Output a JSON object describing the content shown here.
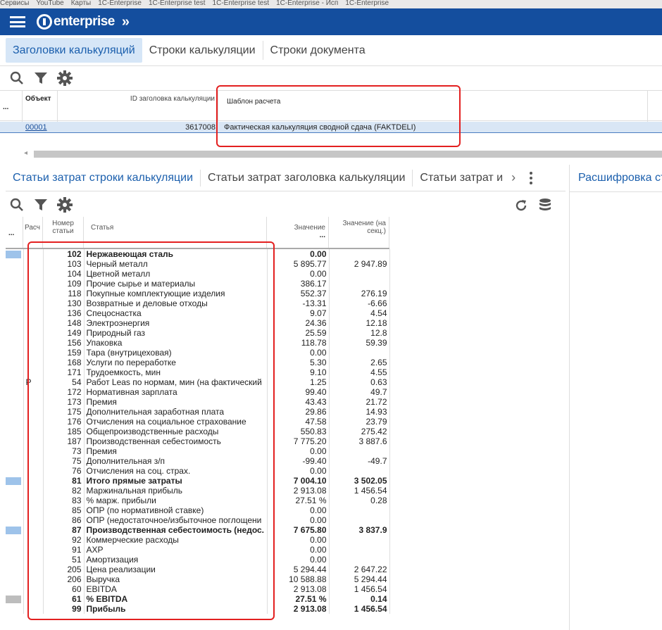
{
  "bookmarks": [
    "Сервисы",
    "YouTube",
    "Карты",
    "1C-Enterprise",
    "1C-Enterprise test",
    "1C-Enterprise test",
    "1C-Enterprise - Исп",
    "1C-Enterprise"
  ],
  "brand": {
    "name": "enterprise",
    "menu_icon": "hamburger-menu-icon",
    "nav_icon": "double-chevron-right-icon",
    "color": "#144e9e"
  },
  "top_tabs": [
    {
      "label": "Заголовки калькуляций",
      "active": true
    },
    {
      "label": "Строки калькуляции",
      "active": false
    },
    {
      "label": "Строки документа",
      "active": false
    }
  ],
  "header_grid": {
    "columns": {
      "more": "...",
      "object": "Объект",
      "id": "ID заголовка калькуляции",
      "template": "Шаблон расчета"
    },
    "row": {
      "object": "00001",
      "id": "3617008",
      "template": "Фактическая калькуляция сводной сдача (FAKTDELI)"
    }
  },
  "bottom_tabs": [
    {
      "label": "Статьи затрат строки калькуляции",
      "active": true
    },
    {
      "label": "Статьи затрат заголовка калькуляции",
      "active": false
    },
    {
      "label": "Статьи затрат и",
      "active": false
    }
  ],
  "bottom_tabs_more": "›",
  "right_panel_title": "Расшифровка ст",
  "lines_grid": {
    "columns": {
      "more": "...",
      "calc": "Расч",
      "number": "Номер статьи",
      "item": "Статья",
      "value": "Значение",
      "value_sub": "...",
      "sec_value": "Значение (на секц.)"
    },
    "rows": [
      {
        "num": "102",
        "name": "Нержавеющая сталь",
        "val": "0.00",
        "sec": "",
        "bold": true,
        "mark": "blue"
      },
      {
        "num": "103",
        "name": "Черный металл",
        "val": "5 895.77",
        "sec": "2 947.89"
      },
      {
        "num": "104",
        "name": "Цветной металл",
        "val": "0.00",
        "sec": ""
      },
      {
        "num": "109",
        "name": "Прочие сырье и материалы",
        "val": "386.17",
        "sec": ""
      },
      {
        "num": "118",
        "name": "Покупные комплектующие изделия",
        "val": "552.37",
        "sec": "276.19"
      },
      {
        "num": "130",
        "name": "Возвратные и деловые отходы",
        "val": "-13.31",
        "sec": "-6.66"
      },
      {
        "num": "136",
        "name": "Спецоснастка",
        "val": "9.07",
        "sec": "4.54"
      },
      {
        "num": "148",
        "name": "Электроэнергия",
        "val": "24.36",
        "sec": "12.18"
      },
      {
        "num": "149",
        "name": "Природный газ",
        "val": "25.59",
        "sec": "12.8"
      },
      {
        "num": "156",
        "name": "Упаковка",
        "val": "118.78",
        "sec": "59.39"
      },
      {
        "num": "159",
        "name": "Тара (внутрицеховая)",
        "val": "0.00",
        "sec": ""
      },
      {
        "num": "168",
        "name": "Услуги по переработке",
        "val": "5.30",
        "sec": "2.65"
      },
      {
        "num": "171",
        "name": "Трудоемкость, мин",
        "val": "9.10",
        "sec": "4.55"
      },
      {
        "num": "54",
        "name": "Работ Leas по нормам, мин (на фактический",
        "val": "1.25",
        "sec": "0.63",
        "calc": "P"
      },
      {
        "num": "172",
        "name": "Нормативная зарплата",
        "val": "99.40",
        "sec": "49.7"
      },
      {
        "num": "173",
        "name": "Премия",
        "val": "43.43",
        "sec": "21.72"
      },
      {
        "num": "175",
        "name": "Дополнительная заработная плата",
        "val": "29.86",
        "sec": "14.93"
      },
      {
        "num": "176",
        "name": "Отчисления на социальное страхование",
        "val": "47.58",
        "sec": "23.79"
      },
      {
        "num": "185",
        "name": "Общепроизводственные расходы",
        "val": "550.83",
        "sec": "275.42"
      },
      {
        "num": "187",
        "name": "Производственная себестоимость",
        "val": "7 775.20",
        "sec": "3 887.6"
      },
      {
        "num": "73",
        "name": "Премия",
        "val": "0.00",
        "sec": ""
      },
      {
        "num": "75",
        "name": "Дополнительная з/п",
        "val": "-99.40",
        "sec": "-49.7"
      },
      {
        "num": "76",
        "name": "Отчисления  на соц. страх.",
        "val": "0.00",
        "sec": ""
      },
      {
        "num": "81",
        "name": "Итого  прямые затраты",
        "val": "7 004.10",
        "sec": "3 502.05",
        "bold": true,
        "mark": "blue"
      },
      {
        "num": "82",
        "name": "Маржинальная прибыль",
        "val": "2 913.08",
        "sec": "1 456.54"
      },
      {
        "num": "83",
        "name": "% марж. прибыли",
        "val": "27.51 %",
        "sec": "0.28"
      },
      {
        "num": "85",
        "name": "ОПР (по нормативной ставке)",
        "val": "0.00",
        "sec": ""
      },
      {
        "num": "86",
        "name": "ОПР (недостаточное/избыточное поглощени",
        "val": "0.00",
        "sec": ""
      },
      {
        "num": "87",
        "name": "Производственная  себестоимость  (недос.",
        "val": "7 675.80",
        "sec": "3 837.9",
        "bold": true,
        "mark": "blue"
      },
      {
        "num": "92",
        "name": "Коммерческие расходы",
        "val": "0.00",
        "sec": ""
      },
      {
        "num": "91",
        "name": "АХР",
        "val": "0.00",
        "sec": ""
      },
      {
        "num": "51",
        "name": "Амортизация",
        "val": "0.00",
        "sec": ""
      },
      {
        "num": "205",
        "name": "Цена реализации",
        "val": "5 294.44",
        "sec": "2 647.22"
      },
      {
        "num": "206",
        "name": "Выручка",
        "val": "10 588.88",
        "sec": "5 294.44"
      },
      {
        "num": "60",
        "name": "EBITDA",
        "val": "2 913.08",
        "sec": "1 456.54"
      },
      {
        "num": "61",
        "name": "% EBITDA",
        "val": "27.51 %",
        "sec": "0.14",
        "bold": true,
        "mark": "gray"
      },
      {
        "num": "99",
        "name": "Прибыль",
        "val": "2 913.08",
        "sec": "1 456.54",
        "bold": true
      }
    ]
  },
  "colors": {
    "accent": "#1b5fad",
    "highlight": "#e32020",
    "mark_blue": "#9ec3ea",
    "mark_gray": "#bdbdbd"
  }
}
